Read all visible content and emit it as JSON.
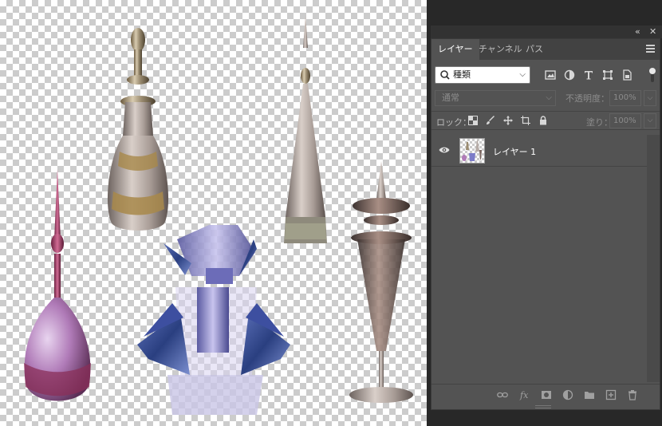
{
  "panel": {
    "tabs": [
      {
        "label": "レイヤー",
        "active": true
      },
      {
        "label": "チャンネル",
        "active": false
      },
      {
        "label": "パス",
        "active": false
      }
    ],
    "collapse_icon": "double-chevron-left-icon",
    "close_icon": "close-icon"
  },
  "filter": {
    "kind_label": "種類",
    "icons": [
      "image-filter-icon",
      "adjustment-filter-icon",
      "type-filter-icon",
      "shape-filter-icon",
      "smart-object-filter-icon"
    ]
  },
  "blend": {
    "mode": "通常",
    "opacity_label": "不透明度：",
    "opacity_value": "100%"
  },
  "lock": {
    "label": "ロック：",
    "fill_label": "塗り：",
    "fill_value": "100%"
  },
  "layers": [
    {
      "name": "レイヤー 1",
      "visible": true
    }
  ],
  "colors": {
    "panel_bg": "#535353",
    "tab_bar": "#424242",
    "app_bg": "#282828"
  }
}
